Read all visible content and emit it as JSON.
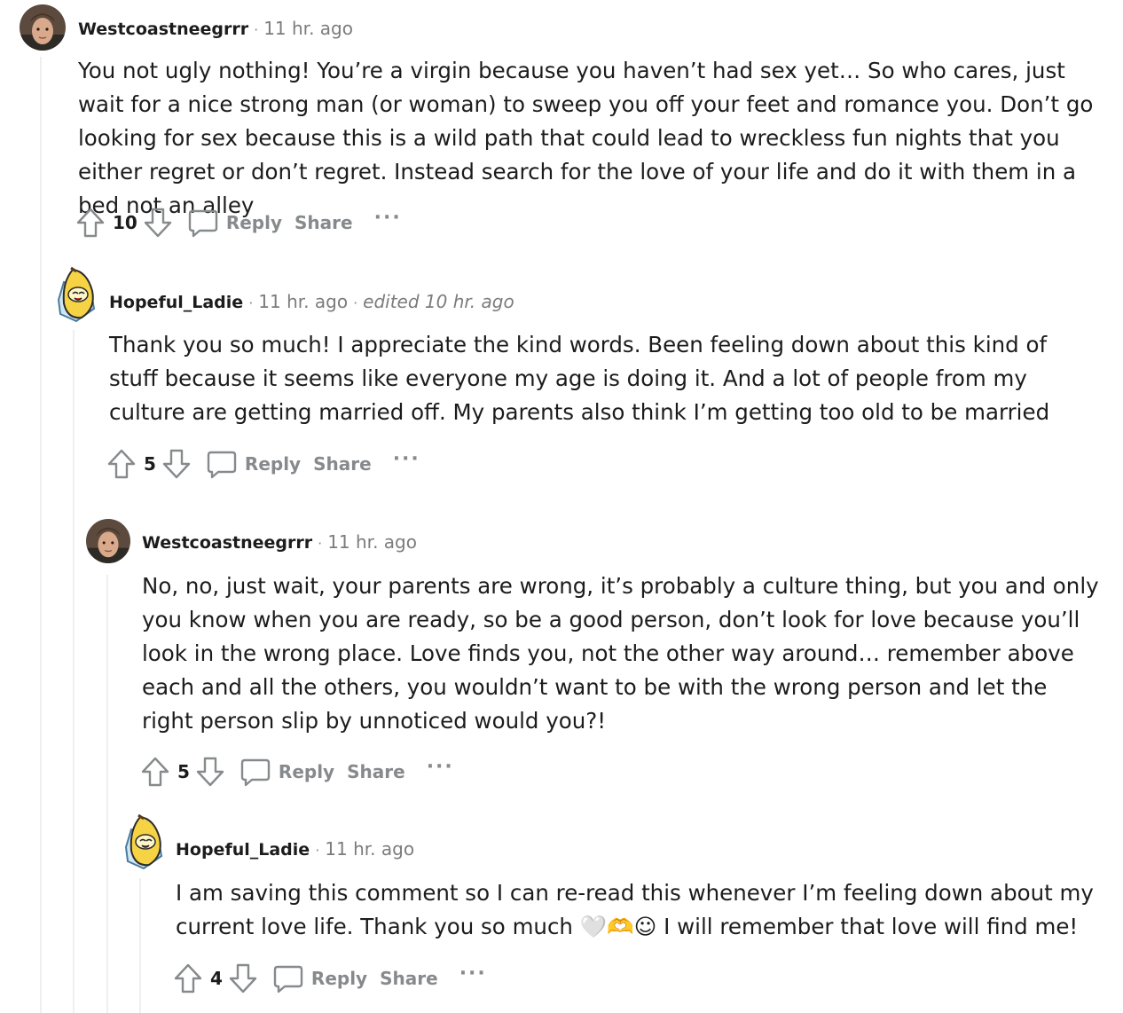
{
  "comments": [
    {
      "username": "Westcoastneegrrr",
      "time": "11 hr. ago",
      "edited": "",
      "body": "You not ugly nothing! You’re a virgin because you haven’t had sex yet… So who cares, just wait for a nice strong man (or woman) to sweep you off your feet and romance you. Don’t go looking for sex because this is a wild path that could lead to wreckless fun nights that you either regret or don’t regret. Instead search for the love of your life and do it with them in a bed not an alley",
      "score": "10",
      "reply": "Reply",
      "share": "Share",
      "more": "···"
    },
    {
      "username": "Hopeful_Ladie",
      "time": "11 hr. ago",
      "edited": "edited 10 hr. ago",
      "body": "Thank you so much! I appreciate the kind words. Been feeling down about this kind of stuff because it seems like everyone my age is doing it. And a lot of people from my culture are getting married off. My parents also think I’m getting too old to be married",
      "score": "5",
      "reply": "Reply",
      "share": "Share",
      "more": "···"
    },
    {
      "username": "Westcoastneegrrr",
      "time": "11 hr. ago",
      "edited": "",
      "body": "No, no, just wait, your parents are wrong, it’s probably a culture thing, but you and only you know when you are ready, so be a good person, don’t look for love because you’ll look in the wrong place. Love finds you, not the other way around… remember above each and all the others, you wouldn’t want to be with the wrong person and let the right person slip by unnoticed would you?!",
      "score": "5",
      "reply": "Reply",
      "share": "Share",
      "more": "···"
    },
    {
      "username": "Hopeful_Ladie",
      "time": "11 hr. ago",
      "edited": "",
      "body": "I am saving this comment so I can re-read this whenever I’m feeling down about my current love life. Thank you so much 🤍🫶☺ I will remember that love will find me!",
      "score": "4",
      "reply": "Reply",
      "share": "Share",
      "more": "···"
    }
  ],
  "icons": {
    "upvote": "upvote-icon",
    "downvote": "downvote-icon",
    "reply": "speech-bubble-icon",
    "more": "ellipsis-icon",
    "avatar_a": "young-man-photo-avatar",
    "avatar_b": "banana-character-avatar"
  },
  "colors": {
    "text": "#1c1c1c",
    "muted": "#878a8c",
    "thread_line": "#edeff1"
  },
  "separator": "·"
}
